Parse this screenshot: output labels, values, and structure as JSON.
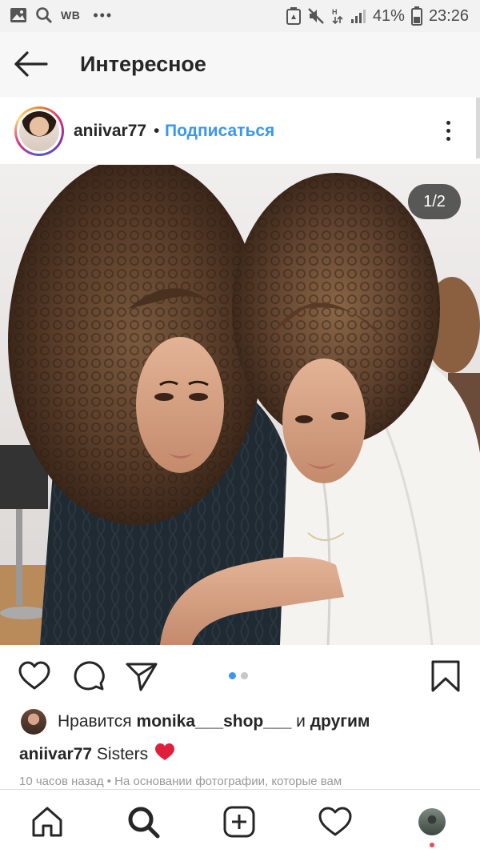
{
  "status_bar": {
    "carrier_label": "WB",
    "more": "•••",
    "battery": "41%",
    "time": "23:26"
  },
  "header": {
    "title": "Интересное"
  },
  "post": {
    "username": "aniivar77",
    "separator": "•",
    "follow_label": "Подписаться",
    "image_counter": "1/2",
    "carousel": {
      "total": 2,
      "active_index": 0
    },
    "liked_by_prefix": "Нравится",
    "liked_by_user": "monika___shop___",
    "liked_by_joiner": "и",
    "liked_by_suffix": "другим",
    "caption_user": "aniivar77",
    "caption_text": "Sisters",
    "caption_emoji": "heart-emoji",
    "meta": "10 часов назад • На основании фотографии, которые вам"
  },
  "icons": {
    "back": "arrow-left-icon",
    "more": "more-vertical-icon",
    "like": "heart-outline-icon",
    "comment": "comment-icon",
    "share": "paper-plane-icon",
    "save": "bookmark-icon"
  },
  "bottom_nav": [
    "home-icon",
    "search-icon",
    "add-post-icon",
    "activity-heart-icon",
    "profile-avatar"
  ],
  "colors": {
    "accent": "#3897f0",
    "text": "#262626",
    "muted": "#999999",
    "emoji_heart": "#e0203a",
    "notification": "#ed4956"
  }
}
